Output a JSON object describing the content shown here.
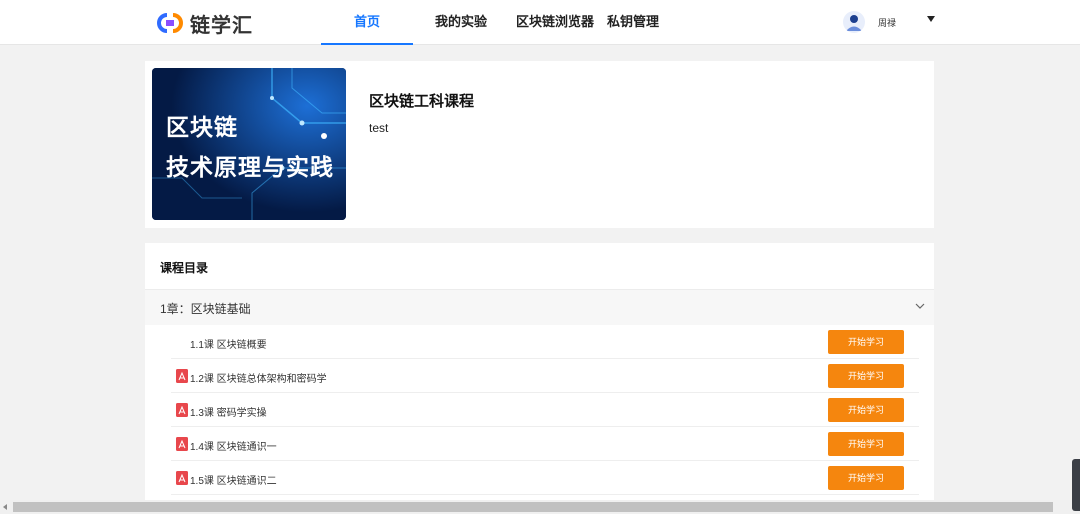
{
  "header": {
    "logo_text": "链学汇",
    "nav": [
      {
        "label": "首页",
        "active": true
      },
      {
        "label": "我的实验",
        "active": false
      },
      {
        "label": "区块链浏览器",
        "active": false
      },
      {
        "label": "私钥管理",
        "active": false
      }
    ],
    "user": {
      "name": "周禄",
      "icon": "avatar-icon"
    }
  },
  "course": {
    "cover": {
      "line1": "区块链",
      "line2": "技术原理与实践"
    },
    "title": "区块链工科课程",
    "description": "test"
  },
  "catalog": {
    "title": "课程目录",
    "chapter": {
      "label": "1章：区块链基础",
      "expanded": true
    },
    "lessons": [
      {
        "label": "1.1课 区块链概要",
        "icon": "",
        "button": "开始学习"
      },
      {
        "label": "1.2课 区块链总体架构和密码学",
        "icon": "pdf-icon",
        "button": "开始学习"
      },
      {
        "label": "1.3课 密码学实操",
        "icon": "pdf-icon",
        "button": "开始学习"
      },
      {
        "label": "1.4课 区块链通识一",
        "icon": "pdf-icon",
        "button": "开始学习"
      },
      {
        "label": "1.5课 区块链通识二",
        "icon": "pdf-icon",
        "button": "开始学习"
      }
    ]
  },
  "colors": {
    "accent": "#1677ff",
    "button": "#f5860e",
    "cover_bg": "#06235a"
  }
}
